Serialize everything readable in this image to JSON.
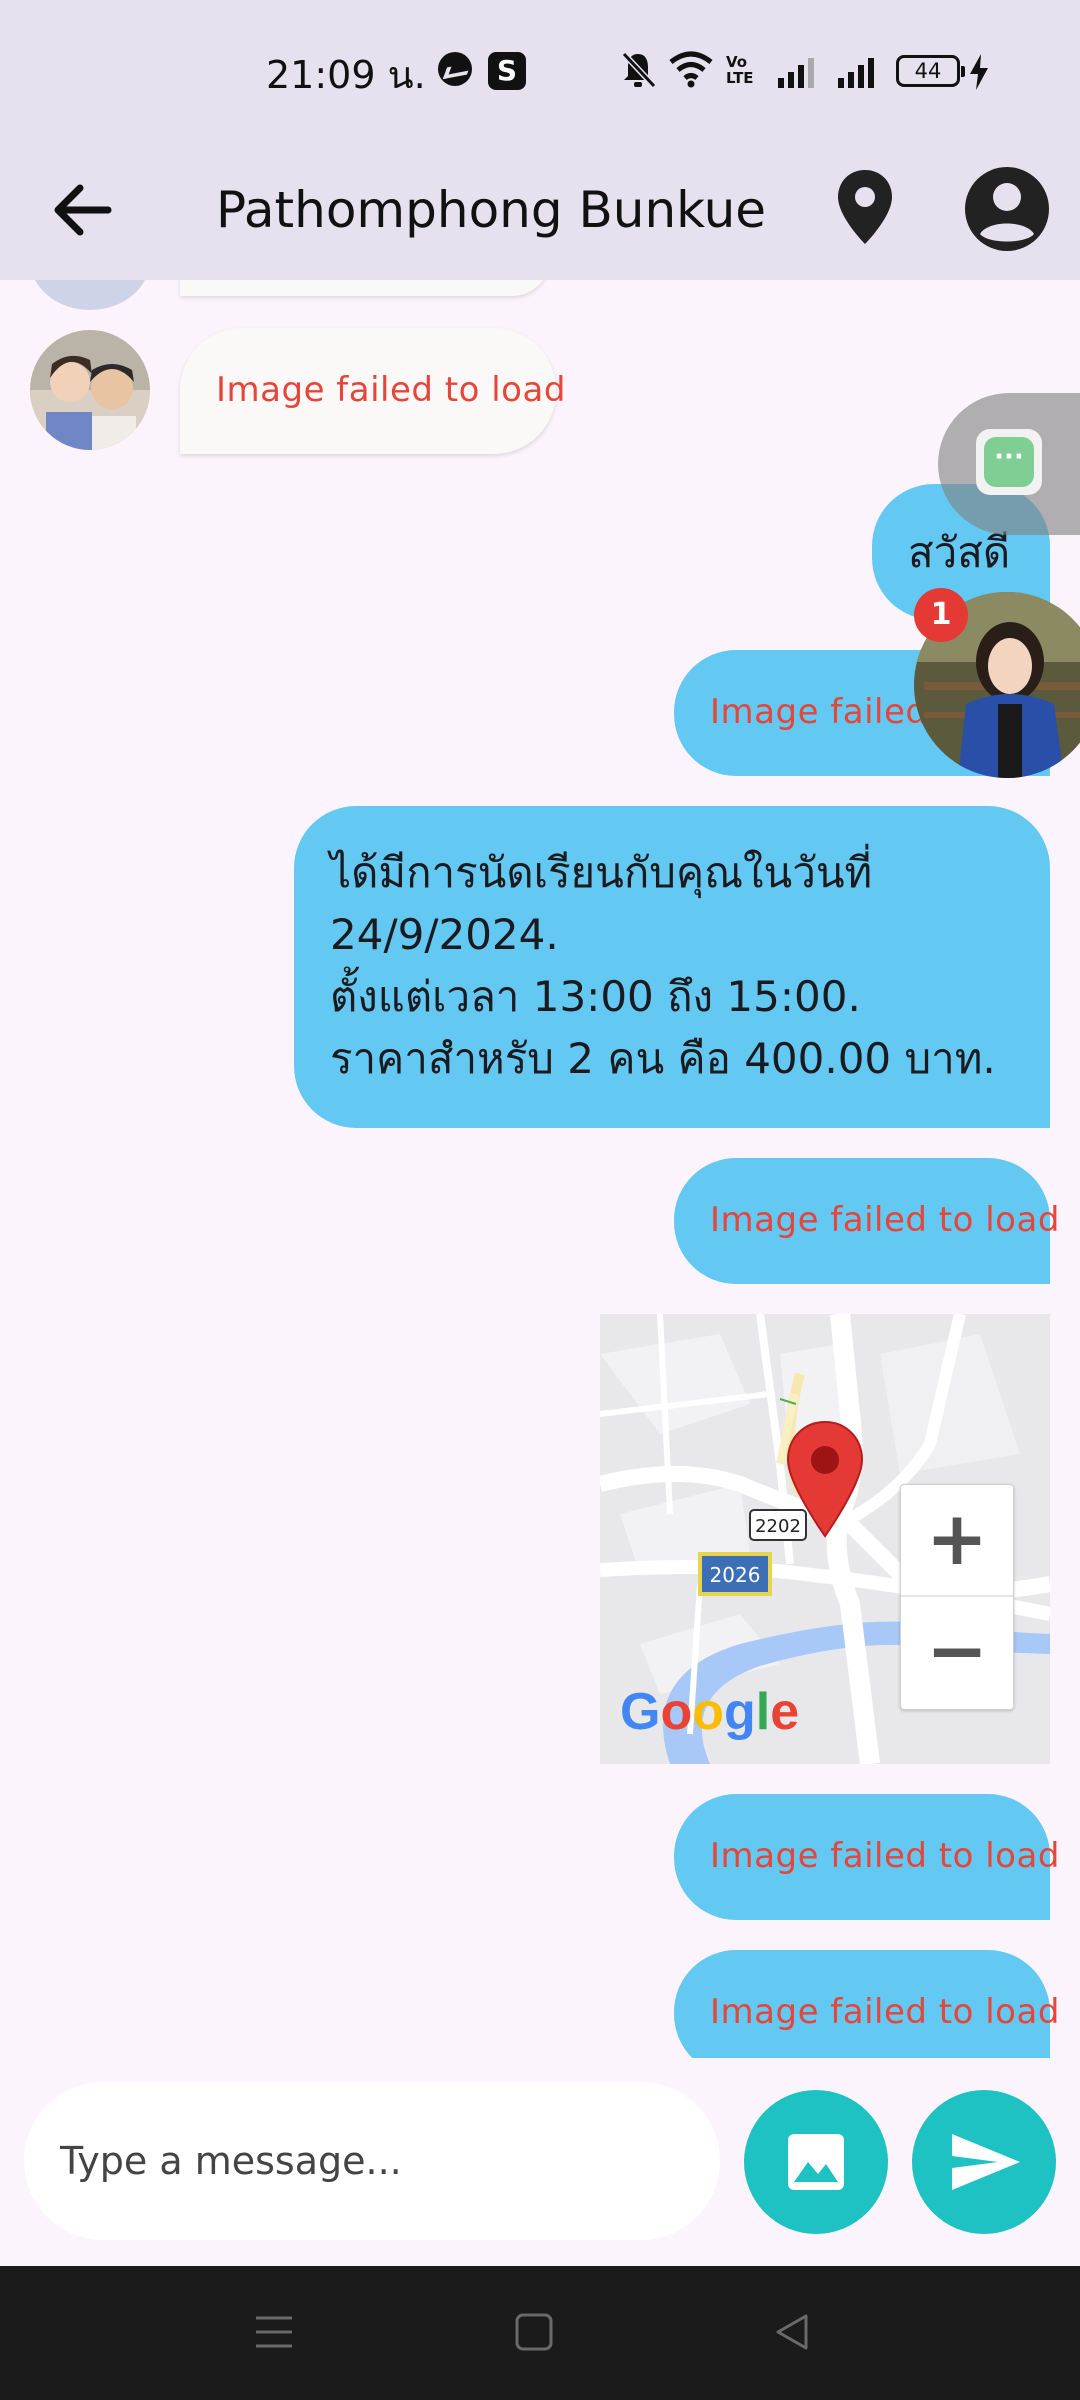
{
  "status_bar": {
    "time": "21:09 น.",
    "s_app_letter": "S",
    "network_label": "Vo LTE",
    "battery_level": "44"
  },
  "header": {
    "title": "Pathomphong Bunkue",
    "back_icon": "arrow-back-icon",
    "location_icon": "location-pin-icon",
    "profile_icon": "account-circle-icon"
  },
  "messages": [
    {
      "direction": "incoming",
      "type": "image",
      "text": "Image failed to load"
    },
    {
      "direction": "outgoing",
      "type": "text",
      "text": "สวัสดี"
    },
    {
      "direction": "outgoing",
      "type": "image",
      "text": "Image failed to load"
    },
    {
      "direction": "outgoing",
      "type": "text",
      "text": "ได้มีการนัดเรียนกับคุณในวันที่ 24/9/2024.\nตั้งแต่เวลา 13:00 ถึง 15:00.\nราคาสำหรับ 2 คน คือ 400.00 บาท."
    },
    {
      "direction": "outgoing",
      "type": "image",
      "text": "Image failed to load"
    },
    {
      "direction": "outgoing",
      "type": "map",
      "road_labels": [
        "2202",
        "2026"
      ],
      "zoom_in": "+",
      "zoom_out": "−",
      "logo": "Google"
    },
    {
      "direction": "outgoing",
      "type": "image",
      "text": "Image failed to load"
    },
    {
      "direction": "outgoing",
      "type": "image",
      "text": "Image failed to load"
    }
  ],
  "chathead": {
    "badge_count": "1"
  },
  "composer": {
    "placeholder": "Type a message...",
    "image_icon": "image-icon",
    "send_icon": "send-icon"
  },
  "colors": {
    "outgoing_bubble": "#63c8f2",
    "incoming_bubble": "#fbf8f8",
    "error_text": "#e5463a",
    "accent_button": "#1fc2c2",
    "app_bar": "#e7e0ee",
    "background": "#fcf4fc"
  }
}
